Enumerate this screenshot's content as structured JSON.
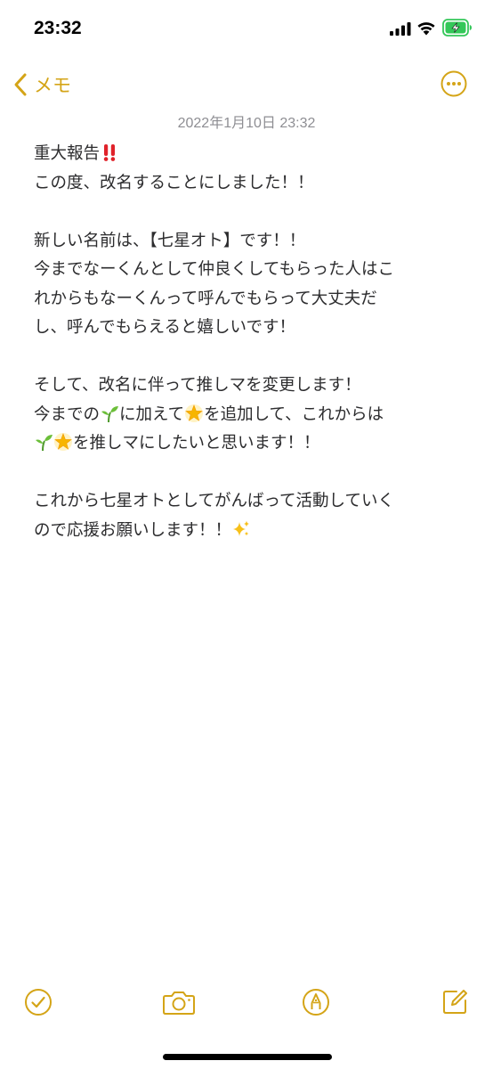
{
  "status_bar": {
    "time": "23:32",
    "icons": [
      "signal-icon",
      "wifi-icon",
      "battery-charging-icon"
    ]
  },
  "nav": {
    "back_label": "メモ",
    "back_icon": "chevron-left-icon",
    "more_icon": "ellipsis-circle-icon"
  },
  "note": {
    "date": "2022年1月10日 23:32",
    "lines": [
      {
        "parts": [
          {
            "text": "重大報告"
          },
          {
            "emoji": "double-exclamation"
          }
        ]
      },
      {
        "parts": [
          {
            "text": "この度、改名することにしました！！"
          }
        ]
      },
      {
        "parts": [
          {
            "text": ""
          }
        ]
      },
      {
        "parts": [
          {
            "text": "新しい名前は、【七星オト】です！！"
          }
        ]
      },
      {
        "parts": [
          {
            "text": "今までなーくんとして仲良くしてもらった人はこ"
          }
        ]
      },
      {
        "parts": [
          {
            "text": "れからもなーくんって呼んでもらって大丈夫だ"
          }
        ]
      },
      {
        "parts": [
          {
            "text": "し、呼んでもらえると嬉しいです！"
          }
        ]
      },
      {
        "parts": [
          {
            "text": ""
          }
        ]
      },
      {
        "parts": [
          {
            "text": "そして、改名に伴って推しマを変更します！"
          }
        ]
      },
      {
        "parts": [
          {
            "text": "今までの"
          },
          {
            "emoji": "seedling"
          },
          {
            "text": "に加えて"
          },
          {
            "emoji": "glowing-star"
          },
          {
            "text": "を追加して、これからは"
          }
        ]
      },
      {
        "parts": [
          {
            "emoji": "seedling"
          },
          {
            "emoji": "glowing-star"
          },
          {
            "text": "を推しマにしたいと思います！！"
          }
        ]
      },
      {
        "parts": [
          {
            "text": ""
          }
        ]
      },
      {
        "parts": [
          {
            "text": "これから七星オトとしてがんばって活動していく"
          }
        ]
      },
      {
        "parts": [
          {
            "text": "ので応援お願いします！！"
          },
          {
            "emoji": "sparkles"
          }
        ]
      }
    ]
  },
  "toolbar": {
    "items": [
      {
        "name": "checklist-button",
        "icon": "checkmark-circle-icon"
      },
      {
        "name": "camera-button",
        "icon": "camera-icon"
      },
      {
        "name": "markup-button",
        "icon": "pen-tip-circle-icon"
      },
      {
        "name": "compose-button",
        "icon": "compose-icon"
      }
    ]
  },
  "colors": {
    "accent": "#d4a417",
    "text": "#2c2c2e",
    "date": "#8e8e93",
    "battery": "#34c759"
  }
}
